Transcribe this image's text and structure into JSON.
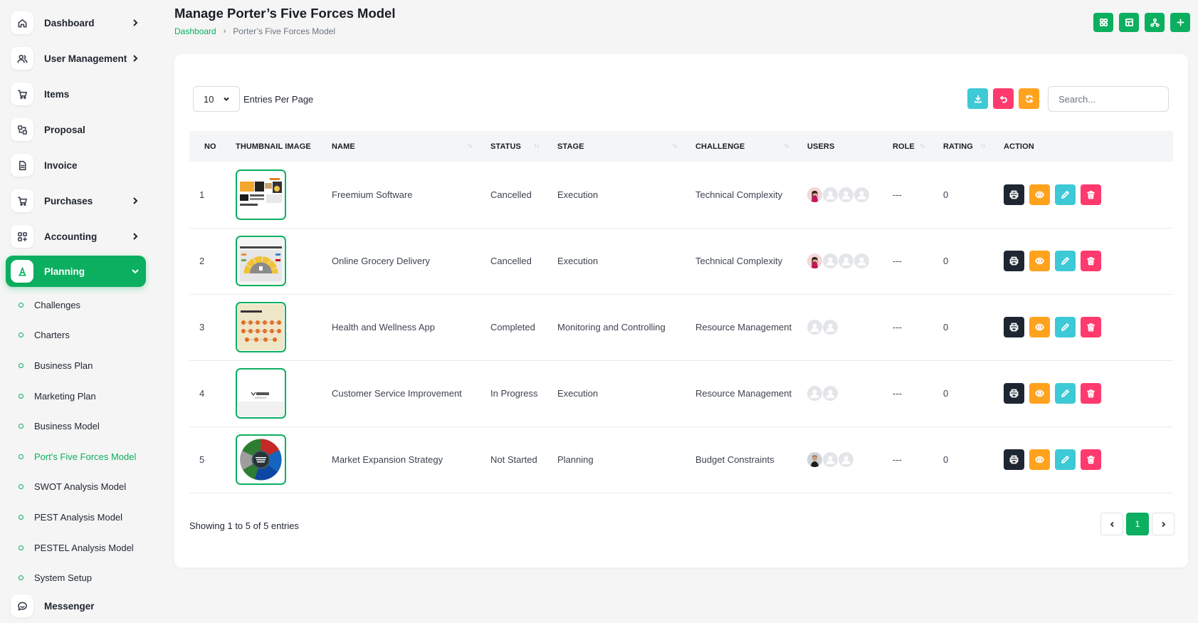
{
  "colors": {
    "accent": "#0caf60",
    "dark": "#1e2632",
    "orange": "#ffa21d",
    "cyan": "#3ec9d6",
    "pink": "#ff3a6e"
  },
  "sidebar": {
    "items": [
      {
        "label": "Dashboard",
        "icon": "home-icon",
        "has_children": true
      },
      {
        "label": "User Management",
        "icon": "users-icon",
        "has_children": true
      },
      {
        "label": "Items",
        "icon": "cart-icon",
        "has_children": false
      },
      {
        "label": "Proposal",
        "icon": "proposal-icon",
        "has_children": false
      },
      {
        "label": "Invoice",
        "icon": "invoice-icon",
        "has_children": false
      },
      {
        "label": "Purchases",
        "icon": "cart-icon",
        "has_children": true
      },
      {
        "label": "Accounting",
        "icon": "apps-icon",
        "has_children": true
      },
      {
        "label": "Planning",
        "icon": "planning-icon",
        "has_children": true,
        "expanded": true
      }
    ],
    "planning_sub": [
      "Challenges",
      "Charters",
      "Business Plan",
      "Marketing Plan",
      "Business Model",
      "Port's Five Forces Model",
      "SWOT Analysis Model",
      "PEST Analysis Model",
      "PESTEL Analysis Model",
      "System Setup"
    ],
    "current_sub": "Port's Five Forces Model",
    "messenger": {
      "label": "Messenger",
      "icon": "chat-icon"
    }
  },
  "header": {
    "title": "Manage Porter’s Five Forces Model",
    "breadcrumb": {
      "home": "Dashboard",
      "current": "Porter’s Five Forces Model"
    },
    "actions": [
      "grid-icon",
      "table-icon",
      "hierarchy-icon",
      "plus-icon"
    ]
  },
  "toolbar": {
    "entries_value": "10",
    "entries_label": "Entries Per Page",
    "search_placeholder": "Search...",
    "tools": [
      "download-icon",
      "undo-icon",
      "refresh-icon"
    ]
  },
  "table": {
    "columns": [
      "NO",
      "THUMBNAIL IMAGE",
      "NAME",
      "STATUS",
      "STAGE",
      "CHALLENGE",
      "USERS",
      "ROLE",
      "RATING",
      "ACTION"
    ],
    "rows": [
      {
        "no": "1",
        "thumb": "presentation-thumb",
        "name": "Freemium Software",
        "status": "Cancelled",
        "stage": "Execution",
        "challenge": "Technical Complexity",
        "users": [
          "photo-female",
          "placeholder",
          "placeholder",
          "placeholder"
        ],
        "role": "---",
        "rating": "0"
      },
      {
        "no": "2",
        "thumb": "gauge-thumb",
        "name": "Online Grocery Delivery",
        "status": "Cancelled",
        "stage": "Execution",
        "challenge": "Technical Complexity",
        "users": [
          "photo-female",
          "placeholder",
          "placeholder",
          "placeholder"
        ],
        "role": "---",
        "rating": "0"
      },
      {
        "no": "3",
        "thumb": "network-thumb",
        "name": "Health and Wellness App",
        "status": "Completed",
        "stage": "Monitoring and Controlling",
        "challenge": "Resource Management",
        "users": [
          "placeholder",
          "placeholder"
        ],
        "role": "---",
        "rating": "0"
      },
      {
        "no": "4",
        "thumb": "logo-thumb",
        "name": "Customer Service Improvement",
        "status": "In Progress",
        "stage": "Execution",
        "challenge": "Resource Management",
        "users": [
          "placeholder",
          "placeholder"
        ],
        "role": "---",
        "rating": "0"
      },
      {
        "no": "5",
        "thumb": "wheel-thumb",
        "name": "Market Expansion Strategy",
        "status": "Not Started",
        "stage": "Planning",
        "challenge": "Budget Constraints",
        "users": [
          "photo-male",
          "placeholder",
          "placeholder"
        ],
        "role": "---",
        "rating": "0"
      }
    ],
    "row_actions": [
      "print-icon",
      "eye-icon",
      "edit-icon",
      "trash-icon"
    ]
  },
  "footer": {
    "showing": "Showing 1 to 5 of 5 entries",
    "page": "1"
  }
}
